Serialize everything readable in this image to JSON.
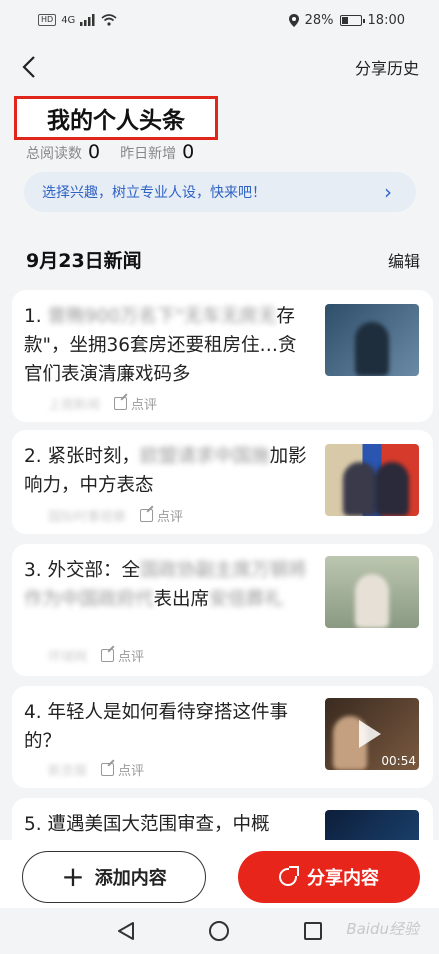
{
  "status": {
    "battery_percent": "28%",
    "time": "18:00",
    "hd": "HD",
    "signal": "4G"
  },
  "header": {
    "back_icon": "chevron-left-icon",
    "share_history": "分享历史"
  },
  "page": {
    "title": "我的个人头条",
    "stats": {
      "total_reads_label": "总阅读数",
      "total_reads": "0",
      "yesterday_label": "昨日新增",
      "yesterday": "0"
    },
    "banner": "选择兴趣，树立专业人设，快来吧！"
  },
  "section": {
    "title": "9月23日新闻",
    "edit": "编辑"
  },
  "news": [
    {
      "index": "1.",
      "headline": "曾贿900万名下\"无车无房无存款\"，坐拥36套房还要租房住…贪官们表演清廉戏码多",
      "source": "上观新闻",
      "comment": "点评"
    },
    {
      "index": "2.",
      "headline": "紧张时刻，欧盟请求中国施加影响力，中方表态",
      "source": "国际时事观察",
      "comment": "点评"
    },
    {
      "index": "3.",
      "headline": "外交部：全国政协副主席万钢将作为中国政府代表出席安倍葬礼",
      "source": "环球网",
      "comment": "点评"
    },
    {
      "index": "4.",
      "headline": "年轻人是如何看待穿搭这件事的？",
      "source": "新京报",
      "comment": "点评",
      "video_duration": "00:54"
    },
    {
      "index": "5.",
      "headline": "遭遇美国大范围审查，中概",
      "source": "",
      "comment": ""
    }
  ],
  "actions": {
    "add_content": "添加内容",
    "share_content": "分享内容"
  },
  "watermark": "Baidu经验"
}
